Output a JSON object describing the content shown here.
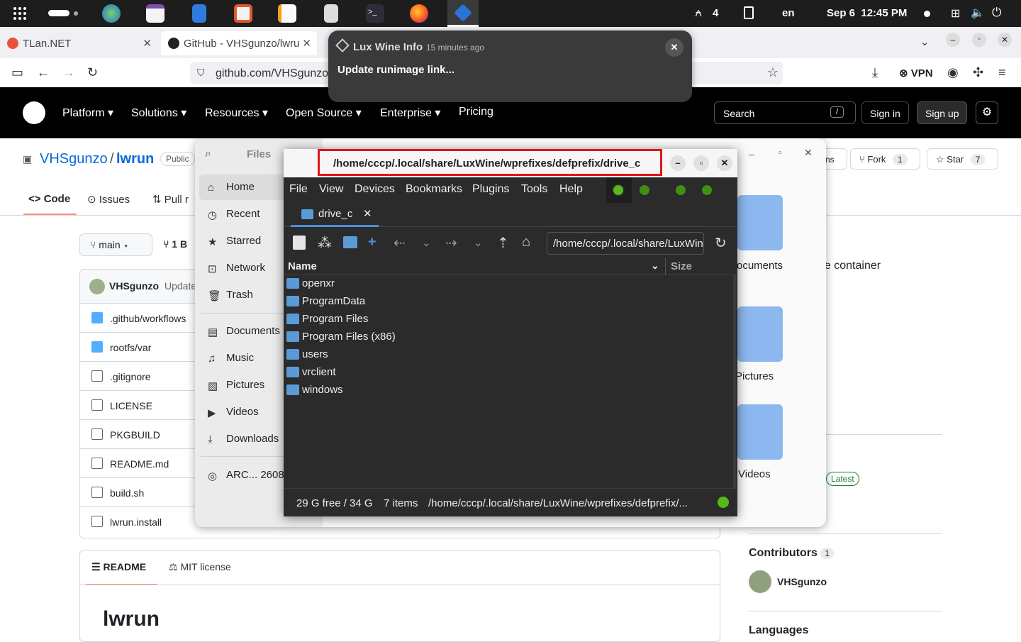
{
  "system_bar": {
    "launcher_icon": "grid-icon",
    "dock_apps": [
      "earth-icon",
      "calendar-icon",
      "phone-icon",
      "store-icon",
      "notes-icon",
      "calculator-icon",
      "terminal-icon",
      "firefox-icon",
      "lux-wine-icon"
    ],
    "notifications_count": "4",
    "language": "en",
    "datetime": "Sep 6  12:45 PM"
  },
  "browser": {
    "tabs": [
      {
        "label": "TLan.NET",
        "active": false
      },
      {
        "label": "GitHub - VHSgunzo/lwrun",
        "active": true
      }
    ],
    "url": "github.com/VHSgunzo",
    "vpn_label": "VPN"
  },
  "github": {
    "nav": [
      "Platform",
      "Solutions",
      "Resources",
      "Open Source",
      "Enterprise",
      "Pricing"
    ],
    "search_placeholder": "Search",
    "search_shortcut": "/",
    "sign_in": "Sign in",
    "sign_up": "Sign up",
    "owner": "VHSgunzo",
    "separator": "/",
    "repo": "lwrun",
    "visibility": "Public",
    "repo_tabs": [
      "Code",
      "Issues",
      "Pull r"
    ],
    "notifications_partial": "ns",
    "fork_label": "Fork",
    "fork_count": "1",
    "star_label": "Star",
    "star_count": "7",
    "branch": "main",
    "branches_partial": "1 B",
    "commit_author": "VHSgunzo",
    "commit_message_partial": "Update",
    "files": [
      ".github/workflows",
      "rootfs/var",
      ".gitignore",
      "LICENSE",
      "PKGBUILD",
      "README.md",
      "build.sh",
      "lwrun.install"
    ],
    "about_partial": "ne container",
    "latest_badge": "Latest",
    "readme_tab": "README",
    "license_tab": "MIT license",
    "readme_title": "lwrun",
    "contributors_label": "Contributors",
    "contributors_count": "1",
    "contributor_name": "VHSgunzo",
    "languages_label": "Languages"
  },
  "files_app": {
    "title": "Files",
    "sidebar": [
      "Home",
      "Recent",
      "Starred",
      "Network",
      "Trash",
      "Documents",
      "Music",
      "Pictures",
      "Videos",
      "Downloads",
      "ARC... 2608"
    ],
    "grid_items": [
      "ocuments",
      "Pictures",
      "Videos"
    ]
  },
  "pcmanfm": {
    "path_title": "/home/cccp/.local/share/LuxWine/wprefixes/defprefix/drive_c",
    "menu": [
      "File",
      "View",
      "Devices",
      "Bookmarks",
      "Plugins",
      "Tools",
      "Help"
    ],
    "tab_label": "drive_c",
    "location": "/home/cccp/.local/share/LuxWine/wprefixes/defprefix/drive_c",
    "col_name": "Name",
    "col_size": "Size",
    "entries": [
      "openxr",
      "ProgramData",
      "Program Files",
      "Program Files (x86)",
      "users",
      "vrclient",
      "windows"
    ],
    "status_free": "29 G free / 34 G",
    "status_items": "7 items",
    "status_path": "/home/cccp/.local/share/LuxWine/wprefixes/defprefix/..."
  },
  "notification": {
    "app": "Lux Wine Info",
    "time": "15 minutes ago",
    "body": "Update runimage link..."
  }
}
